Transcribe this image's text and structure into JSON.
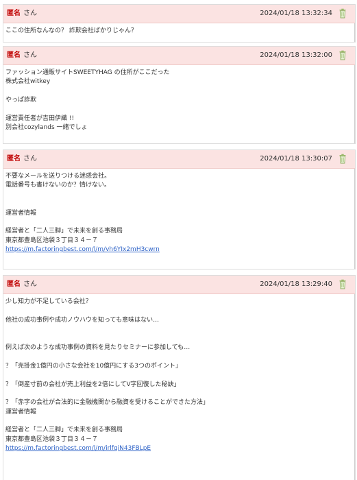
{
  "posts": [
    {
      "author": "匿名",
      "suffix": "さん",
      "timestamp": "2024/01/18 13:32:34",
      "lines": [
        "ここの住所なんなの？ 詐欺会社ばかりじゃん？"
      ],
      "link": null
    },
    {
      "author": "匿名",
      "suffix": "さん",
      "timestamp": "2024/01/18 13:32:00",
      "lines": [
        "ファッション通販サイトSWEETYHAG の住所がここだった",
        "株式会社witkey",
        "",
        "やっぱ詐欺",
        "",
        "運営責任者が吉田伊織 !!",
        "別会社cozylands 一緒でしょ"
      ],
      "link": null
    },
    {
      "author": "匿名",
      "suffix": "さん",
      "timestamp": "2024/01/18 13:30:07",
      "lines": [
        "不要なメールを送りつける迷惑会社。",
        "電話番号も書けないのか？情けない。",
        "",
        "",
        "運営者情報",
        "",
        "経営者と「二人三脚」で未来を創る事務局",
        "東京都豊島区池袋３丁目３４－７"
      ],
      "link": "https://m.factoringbest.com/l/m/vh6YIx2mH3cwrn"
    },
    {
      "author": "匿名",
      "suffix": "さん",
      "timestamp": "2024/01/18 13:29:40",
      "lines": [
        "少し知力が不足している会社？",
        "",
        "他社の成功事例や成功ノウハウを知っても意味はない…",
        "",
        "",
        "例えば次のような成功事例の資料を見たりセミナーに参加しても…",
        "",
        "？「売掛金1億円の小さな会社を10億円にする3つのポイント」",
        "",
        "？「倒産寸前の会社が売上利益を2倍にしてV字回復した秘訣」",
        "",
        "？「赤字の会社が合法的に金融機関から融資を受けることができた方法」",
        "運営者情報",
        "",
        "経営者と「二人三脚」で未来を創る事務局",
        "東京都豊島区池袋３丁目３４－７"
      ],
      "link": "https://m.factoringbest.com/l/m/irlfqiN43FBLpE"
    }
  ],
  "colors": {
    "header_bg": "#fbe3e2",
    "author": "#c00000",
    "link": "#2d62c7"
  },
  "icons": {
    "delete": "trash-icon"
  }
}
